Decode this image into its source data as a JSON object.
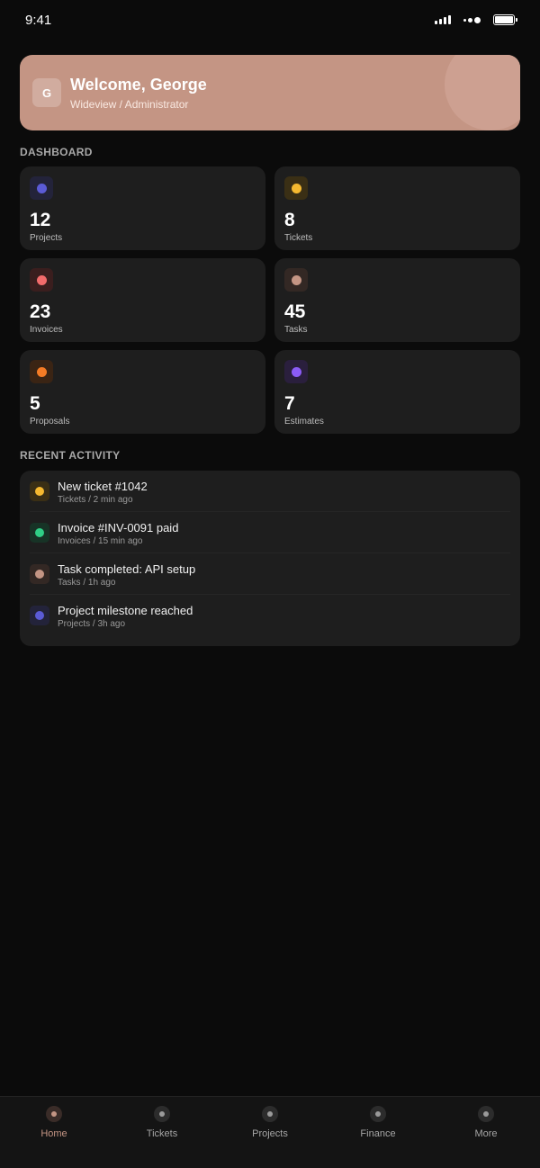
{
  "status_bar": {
    "time": "9:41"
  },
  "welcome": {
    "avatar_initial": "G",
    "title": "Welcome, George",
    "subtitle": "Wideview / Administrator",
    "background_color": "#c49584"
  },
  "dashboard": {
    "section_title": "DASHBOARD",
    "stats": [
      {
        "value": "12",
        "label": "Projects",
        "icon": "projects-dot-icon",
        "color": "#5b5bd6",
        "bg": "#23233a"
      },
      {
        "value": "8",
        "label": "Tickets",
        "icon": "tickets-dot-icon",
        "color": "#f5b930",
        "bg": "#3a2f15"
      },
      {
        "value": "23",
        "label": "Invoices",
        "icon": "invoices-dot-icon",
        "color": "#f26b6b",
        "bg": "#3a1e1e"
      },
      {
        "value": "45",
        "label": "Tasks",
        "icon": "tasks-dot-icon",
        "color": "#c49584",
        "bg": "#332824"
      },
      {
        "value": "5",
        "label": "Proposals",
        "icon": "proposals-dot-icon",
        "color": "#f47b25",
        "bg": "#3a2414"
      },
      {
        "value": "7",
        "label": "Estimates",
        "icon": "estimates-dot-icon",
        "color": "#8b5cf6",
        "bg": "#2a1f3d"
      }
    ]
  },
  "recent_activity": {
    "section_title": "RECENT ACTIVITY",
    "items": [
      {
        "title": "New ticket #1042",
        "meta": "Tickets / 2 min ago",
        "icon": "ticket-dot-icon",
        "color": "#f5b930",
        "bg": "#3a2f15"
      },
      {
        "title": "Invoice #INV-0091 paid",
        "meta": "Invoices / 15 min ago",
        "icon": "invoice-dot-icon",
        "color": "#2fcf86",
        "bg": "#173326"
      },
      {
        "title": "Task completed: API setup",
        "meta": "Tasks / 1h ago",
        "icon": "task-dot-icon",
        "color": "#c49584",
        "bg": "#332824"
      },
      {
        "title": "Project milestone reached",
        "meta": "Projects / 3h ago",
        "icon": "project-dot-icon",
        "color": "#5b5bd6",
        "bg": "#23233a"
      }
    ]
  },
  "bottom_nav": {
    "items": [
      {
        "label": "Home",
        "icon": "home-icon",
        "active": true
      },
      {
        "label": "Tickets",
        "icon": "tickets-icon",
        "active": false
      },
      {
        "label": "Projects",
        "icon": "projects-icon",
        "active": false
      },
      {
        "label": "Finance",
        "icon": "finance-icon",
        "active": false
      },
      {
        "label": "More",
        "icon": "more-icon",
        "active": false
      }
    ]
  }
}
